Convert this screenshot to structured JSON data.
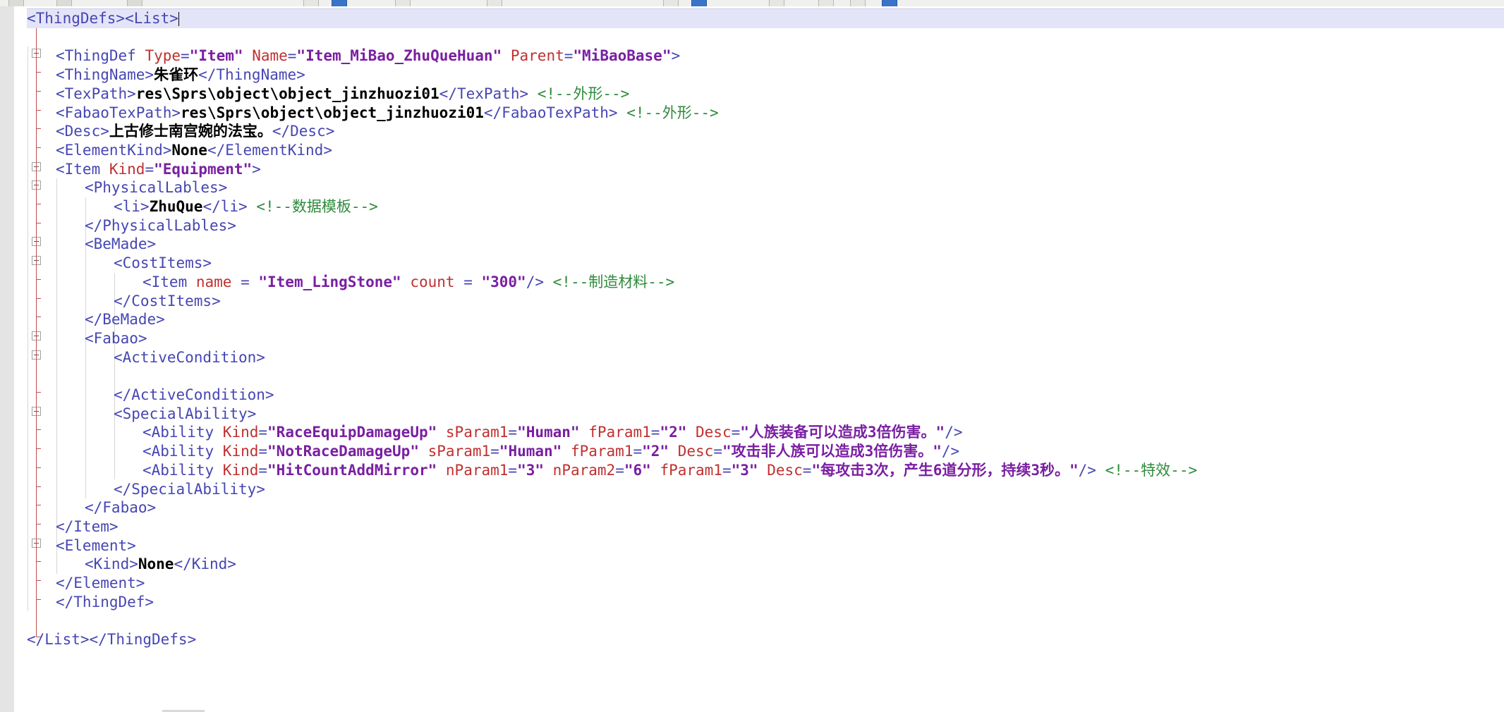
{
  "app": {
    "type": "xml-code-editor",
    "document_language": "XML",
    "colors": {
      "tag": "#4646b4",
      "attribute": "#c03030",
      "value": "#7a1fa2",
      "text": "#000000",
      "comment": "#2e8b3c",
      "selection_line": "#e4e4f8",
      "fold_margin": "#c05050",
      "selection_margin": "#e4e4e4",
      "background": "#ffffff"
    }
  },
  "toolbar": {
    "buttons": [
      {
        "name": "toolbar-button-1",
        "style": "pale"
      },
      {
        "name": "toolbar-button-2",
        "style": "pale"
      },
      {
        "name": "toolbar-button-3",
        "style": "pale"
      },
      {
        "name": "toolbar-button-4",
        "style": "plain"
      },
      {
        "name": "toolbar-button-5",
        "style": "blue"
      },
      {
        "name": "toolbar-button-6",
        "style": "plain"
      },
      {
        "name": "toolbar-button-7",
        "style": "plain"
      },
      {
        "name": "toolbar-button-8",
        "style": "plain"
      },
      {
        "name": "toolbar-button-9",
        "style": "blue"
      },
      {
        "name": "toolbar-button-10",
        "style": "plain"
      },
      {
        "name": "toolbar-button-11",
        "style": "plain"
      },
      {
        "name": "toolbar-button-12",
        "style": "plain"
      },
      {
        "name": "toolbar-button-13",
        "style": "blue"
      }
    ]
  },
  "code": {
    "lines": [
      {
        "n": 1,
        "indent": 0,
        "selected": true,
        "fold": "box-open-top",
        "segments": [
          {
            "t": "tag",
            "s": "<ThingDefs><List>"
          },
          {
            "t": "caret",
            "s": ""
          }
        ]
      },
      {
        "n": 2,
        "indent": 0,
        "segments": []
      },
      {
        "n": 3,
        "indent": 1,
        "fold": "box-grey",
        "segments": [
          {
            "t": "tag",
            "s": "<ThingDef "
          },
          {
            "t": "attr",
            "s": "Type"
          },
          {
            "t": "op",
            "s": "="
          },
          {
            "t": "val",
            "s": "\"Item\""
          },
          {
            "t": "tag",
            "s": " "
          },
          {
            "t": "attr",
            "s": "Name"
          },
          {
            "t": "op",
            "s": "="
          },
          {
            "t": "val",
            "s": "\"Item_MiBao_ZhuQueHuan\""
          },
          {
            "t": "tag",
            "s": " "
          },
          {
            "t": "attr",
            "s": "Parent"
          },
          {
            "t": "op",
            "s": "="
          },
          {
            "t": "val",
            "s": "\"MiBaoBase\""
          },
          {
            "t": "tag",
            "s": ">"
          }
        ]
      },
      {
        "n": 4,
        "indent": 1,
        "segments": [
          {
            "t": "tag",
            "s": "<ThingName>"
          },
          {
            "t": "cn",
            "s": "朱雀环"
          },
          {
            "t": "tag",
            "s": "</ThingName>"
          }
        ]
      },
      {
        "n": 5,
        "indent": 1,
        "segments": [
          {
            "t": "tag",
            "s": "<TexPath>"
          },
          {
            "t": "txt",
            "s": "res\\Sprs\\object\\object_jinzhuozi01"
          },
          {
            "t": "tag",
            "s": "</TexPath>"
          },
          {
            "t": "plain",
            "s": " "
          },
          {
            "t": "cmt",
            "s": "<!--外形-->"
          }
        ]
      },
      {
        "n": 6,
        "indent": 1,
        "segments": [
          {
            "t": "tag",
            "s": "<FabaoTexPath>"
          },
          {
            "t": "txt",
            "s": "res\\Sprs\\object\\object_jinzhuozi01"
          },
          {
            "t": "tag",
            "s": "</FabaoTexPath>"
          },
          {
            "t": "plain",
            "s": " "
          },
          {
            "t": "cmt",
            "s": "<!--外形-->"
          }
        ]
      },
      {
        "n": 7,
        "indent": 1,
        "segments": [
          {
            "t": "tag",
            "s": "<Desc>"
          },
          {
            "t": "cn",
            "s": "上古修士南宫婉的法宝。"
          },
          {
            "t": "tag",
            "s": "</Desc>"
          }
        ]
      },
      {
        "n": 8,
        "indent": 1,
        "segments": [
          {
            "t": "tag",
            "s": "<ElementKind>"
          },
          {
            "t": "txt",
            "s": "None"
          },
          {
            "t": "tag",
            "s": "</ElementKind>"
          }
        ]
      },
      {
        "n": 9,
        "indent": 1,
        "fold": "box-grey",
        "segments": [
          {
            "t": "tag",
            "s": "<Item "
          },
          {
            "t": "attr",
            "s": "Kind"
          },
          {
            "t": "op",
            "s": "="
          },
          {
            "t": "val",
            "s": "\"Equipment\""
          },
          {
            "t": "tag",
            "s": ">"
          }
        ]
      },
      {
        "n": 10,
        "indent": 2,
        "fold": "box-grey",
        "segments": [
          {
            "t": "tag",
            "s": "<PhysicalLables>"
          }
        ]
      },
      {
        "n": 11,
        "indent": 3,
        "segments": [
          {
            "t": "tag",
            "s": "<li>"
          },
          {
            "t": "txt",
            "s": "ZhuQue"
          },
          {
            "t": "tag",
            "s": "</li>"
          },
          {
            "t": "plain",
            "s": " "
          },
          {
            "t": "cmt",
            "s": "<!--数据模板-->"
          }
        ]
      },
      {
        "n": 12,
        "indent": 2,
        "segments": [
          {
            "t": "tag",
            "s": "</PhysicalLables>"
          }
        ]
      },
      {
        "n": 13,
        "indent": 2,
        "fold": "box-grey",
        "segments": [
          {
            "t": "tag",
            "s": "<BeMade>"
          }
        ]
      },
      {
        "n": 14,
        "indent": 3,
        "fold": "box-grey",
        "segments": [
          {
            "t": "tag",
            "s": "<CostItems>"
          }
        ]
      },
      {
        "n": 15,
        "indent": 4,
        "segments": [
          {
            "t": "tag",
            "s": "<Item "
          },
          {
            "t": "attr",
            "s": "name "
          },
          {
            "t": "op",
            "s": "= "
          },
          {
            "t": "val",
            "s": "\"Item_LingStone\""
          },
          {
            "t": "plain",
            "s": " "
          },
          {
            "t": "attr",
            "s": "count "
          },
          {
            "t": "op",
            "s": "= "
          },
          {
            "t": "val",
            "s": "\"300\""
          },
          {
            "t": "tag",
            "s": "/>"
          },
          {
            "t": "plain",
            "s": " "
          },
          {
            "t": "cmt",
            "s": "<!--制造材料-->"
          }
        ]
      },
      {
        "n": 16,
        "indent": 3,
        "segments": [
          {
            "t": "tag",
            "s": "</CostItems>"
          }
        ]
      },
      {
        "n": 17,
        "indent": 2,
        "segments": [
          {
            "t": "tag",
            "s": "</BeMade>"
          }
        ]
      },
      {
        "n": 18,
        "indent": 2,
        "fold": "box-grey",
        "segments": [
          {
            "t": "tag",
            "s": "<Fabao>"
          }
        ]
      },
      {
        "n": 19,
        "indent": 3,
        "fold": "box-grey",
        "segments": [
          {
            "t": "tag",
            "s": "<ActiveCondition>"
          }
        ]
      },
      {
        "n": 20,
        "indent": 0,
        "segments": []
      },
      {
        "n": 21,
        "indent": 3,
        "segments": [
          {
            "t": "tag",
            "s": "</ActiveCondition>"
          }
        ]
      },
      {
        "n": 22,
        "indent": 3,
        "fold": "box-grey",
        "segments": [
          {
            "t": "tag",
            "s": "<SpecialAbility>"
          }
        ]
      },
      {
        "n": 23,
        "indent": 4,
        "segments": [
          {
            "t": "tag",
            "s": "<Ability "
          },
          {
            "t": "attr",
            "s": "Kind"
          },
          {
            "t": "op",
            "s": "="
          },
          {
            "t": "val",
            "s": "\"RaceEquipDamageUp\""
          },
          {
            "t": "plain",
            "s": " "
          },
          {
            "t": "attr",
            "s": "sParam1"
          },
          {
            "t": "op",
            "s": "="
          },
          {
            "t": "val",
            "s": "\"Human\""
          },
          {
            "t": "plain",
            "s": " "
          },
          {
            "t": "attr",
            "s": "fParam1"
          },
          {
            "t": "op",
            "s": "="
          },
          {
            "t": "val",
            "s": "\"2\""
          },
          {
            "t": "plain",
            "s": " "
          },
          {
            "t": "attr",
            "s": "Desc"
          },
          {
            "t": "op",
            "s": "="
          },
          {
            "t": "val",
            "s": "\"人族装备可以造成3倍伤害。\""
          },
          {
            "t": "tag",
            "s": "/>"
          }
        ]
      },
      {
        "n": 24,
        "indent": 4,
        "segments": [
          {
            "t": "tag",
            "s": "<Ability "
          },
          {
            "t": "attr",
            "s": "Kind"
          },
          {
            "t": "op",
            "s": "="
          },
          {
            "t": "val",
            "s": "\"NotRaceDamageUp\""
          },
          {
            "t": "plain",
            "s": " "
          },
          {
            "t": "attr",
            "s": "sParam1"
          },
          {
            "t": "op",
            "s": "="
          },
          {
            "t": "val",
            "s": "\"Human\""
          },
          {
            "t": "plain",
            "s": " "
          },
          {
            "t": "attr",
            "s": "fParam1"
          },
          {
            "t": "op",
            "s": "="
          },
          {
            "t": "val",
            "s": "\"2\""
          },
          {
            "t": "plain",
            "s": " "
          },
          {
            "t": "attr",
            "s": "Desc"
          },
          {
            "t": "op",
            "s": "="
          },
          {
            "t": "val",
            "s": "\"攻击非人族可以造成3倍伤害。\""
          },
          {
            "t": "tag",
            "s": "/>"
          }
        ]
      },
      {
        "n": 25,
        "indent": 4,
        "segments": [
          {
            "t": "tag",
            "s": "<Ability "
          },
          {
            "t": "attr",
            "s": "Kind"
          },
          {
            "t": "op",
            "s": "="
          },
          {
            "t": "val",
            "s": "\"HitCountAddMirror\""
          },
          {
            "t": "plain",
            "s": " "
          },
          {
            "t": "attr",
            "s": "nParam1"
          },
          {
            "t": "op",
            "s": "="
          },
          {
            "t": "val",
            "s": "\"3\""
          },
          {
            "t": "plain",
            "s": " "
          },
          {
            "t": "attr",
            "s": "nParam2"
          },
          {
            "t": "op",
            "s": "="
          },
          {
            "t": "val",
            "s": "\"6\""
          },
          {
            "t": "plain",
            "s": " "
          },
          {
            "t": "attr",
            "s": "fParam1"
          },
          {
            "t": "op",
            "s": "="
          },
          {
            "t": "val",
            "s": "\"3\""
          },
          {
            "t": "plain",
            "s": " "
          },
          {
            "t": "attr",
            "s": "Desc"
          },
          {
            "t": "op",
            "s": "="
          },
          {
            "t": "val",
            "s": "\"每攻击3次，产生6道分形，持续3秒。\""
          },
          {
            "t": "tag",
            "s": "/>"
          },
          {
            "t": "plain",
            "s": " "
          },
          {
            "t": "cmt",
            "s": "<!--特效-->"
          }
        ]
      },
      {
        "n": 26,
        "indent": 3,
        "segments": [
          {
            "t": "tag",
            "s": "</SpecialAbility>"
          }
        ]
      },
      {
        "n": 27,
        "indent": 2,
        "segments": [
          {
            "t": "tag",
            "s": "</Fabao>"
          }
        ]
      },
      {
        "n": 28,
        "indent": 1,
        "segments": [
          {
            "t": "tag",
            "s": "</Item>"
          }
        ]
      },
      {
        "n": 29,
        "indent": 1,
        "fold": "box-grey",
        "segments": [
          {
            "t": "tag",
            "s": "<Element>"
          }
        ]
      },
      {
        "n": 30,
        "indent": 2,
        "segments": [
          {
            "t": "tag",
            "s": "<Kind>"
          },
          {
            "t": "txt",
            "s": "None"
          },
          {
            "t": "tag",
            "s": "</Kind>"
          }
        ]
      },
      {
        "n": 31,
        "indent": 1,
        "segments": [
          {
            "t": "tag",
            "s": "</Element>"
          }
        ]
      },
      {
        "n": 32,
        "indent": 1,
        "segments": [
          {
            "t": "tag",
            "s": "</ThingDef>"
          }
        ]
      },
      {
        "n": 33,
        "indent": 0,
        "segments": []
      },
      {
        "n": 34,
        "indent": 0,
        "fold": "elbow",
        "segments": [
          {
            "t": "tag",
            "s": "</List></ThingDefs>"
          }
        ]
      }
    ]
  }
}
